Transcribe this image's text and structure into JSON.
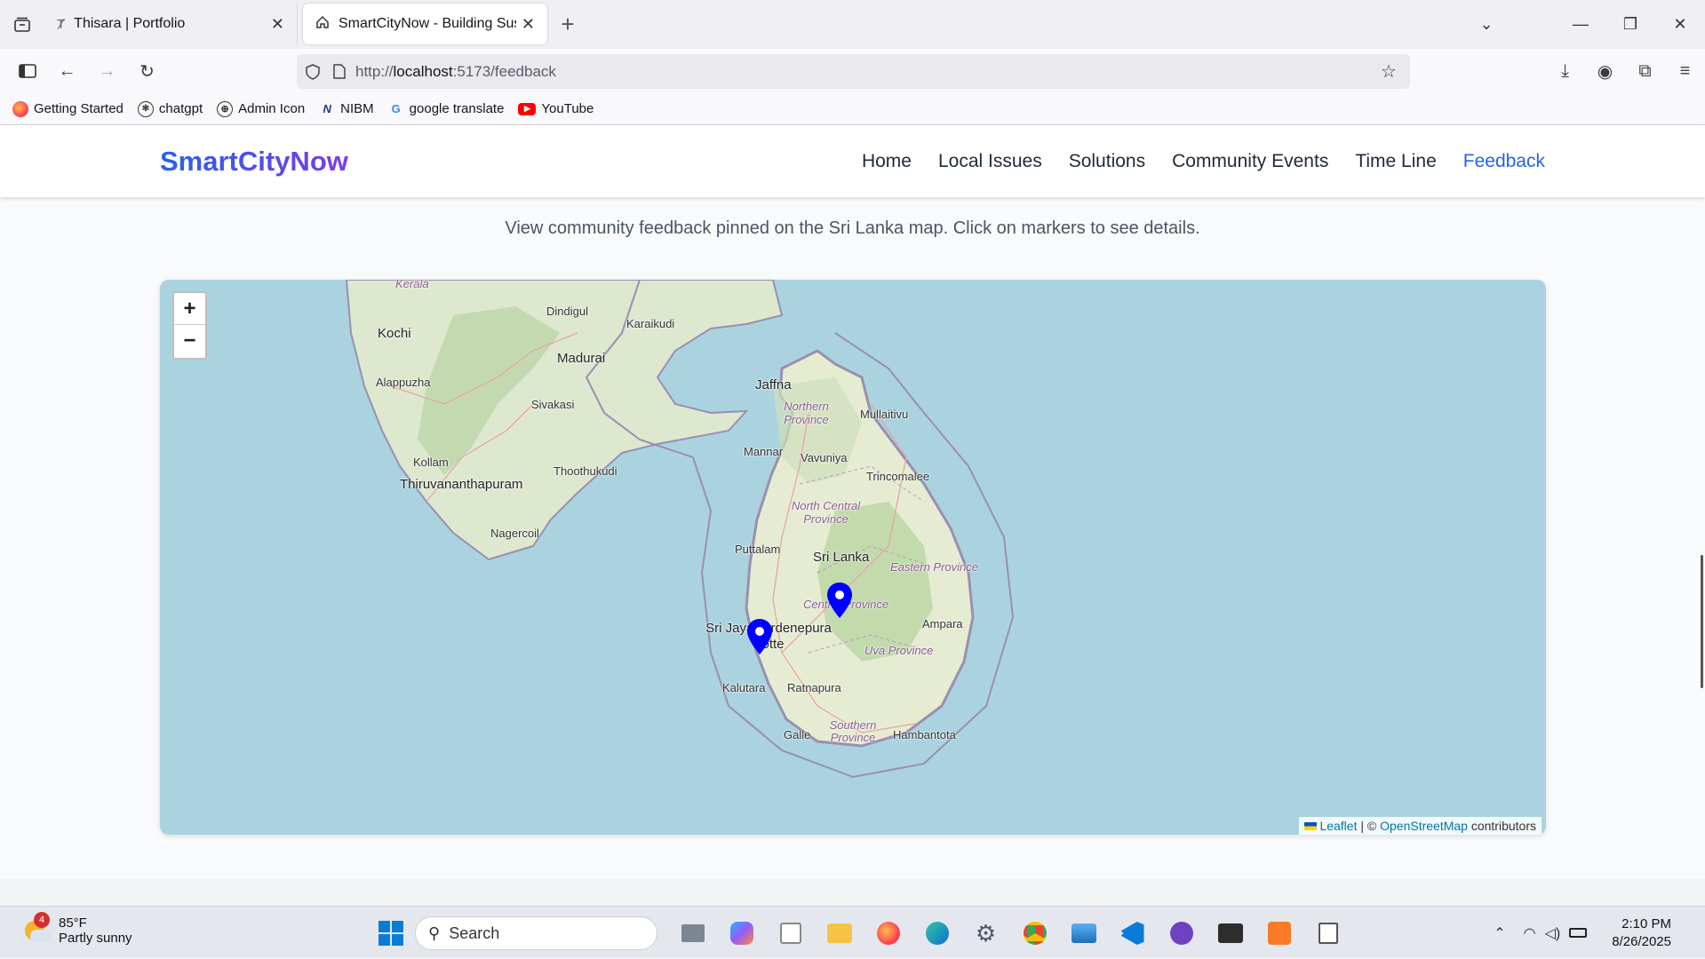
{
  "browser": {
    "tabs": [
      {
        "title": "Thisara | Portfolio",
        "active": false
      },
      {
        "title": "SmartCityNow - Building Sustai",
        "active": true
      }
    ],
    "url_prefix": "http://",
    "url_host": "localhost",
    "url_rest": ":5173/feedback",
    "bookmarks": [
      {
        "label": "Getting Started",
        "icon": "firefox-icon"
      },
      {
        "label": "chatgpt",
        "icon": "chatgpt-icon"
      },
      {
        "label": "Admin Icon",
        "icon": "globe-icon"
      },
      {
        "label": "NIBM",
        "icon": "nibm-icon"
      },
      {
        "label": "google translate",
        "icon": "google-icon"
      },
      {
        "label": "YouTube",
        "icon": "youtube-icon"
      }
    ]
  },
  "site": {
    "logo": "SmartCityNow",
    "nav": [
      "Home",
      "Local Issues",
      "Solutions",
      "Community Events",
      "Time Line",
      "Feedback"
    ],
    "active_nav": "Feedback",
    "intro": "View community feedback pinned on the Sri Lanka map. Click on markers to see details."
  },
  "map": {
    "zoom_in": "+",
    "zoom_out": "−",
    "attribution": {
      "leaflet": "Leaflet",
      "sep": " | © ",
      "osm": "OpenStreetMap",
      "rest": " contributors"
    },
    "places": [
      "Kerala",
      "Dindigul",
      "Karaikudi",
      "Kochi",
      "Madurai",
      "Alappuzha",
      "Sivakasi",
      "Kollam",
      "Thoothukudi",
      "Thiruvananthapuram",
      "Nagercoil",
      "Jaffna",
      "Northern Province",
      "Mullaitivu",
      "Mannar",
      "Vavuniya",
      "Trincomalee",
      "North Central Province",
      "Puttalam",
      "Sri Lanka",
      "Eastern Province",
      "Central Province",
      "Sri Jayawardenepura Kotte",
      "Ampara",
      "Uva Province",
      "Kalutara",
      "Ratnapura",
      "Southern Province",
      "Galle",
      "Hambantota"
    ],
    "marker_count": 2,
    "marker_color": "#0000ff"
  },
  "taskbar": {
    "weather_badge": "4",
    "temperature": "85°F",
    "weather": "Partly sunny",
    "search": "Search",
    "time": "2:10 PM",
    "date": "8/26/2025"
  }
}
